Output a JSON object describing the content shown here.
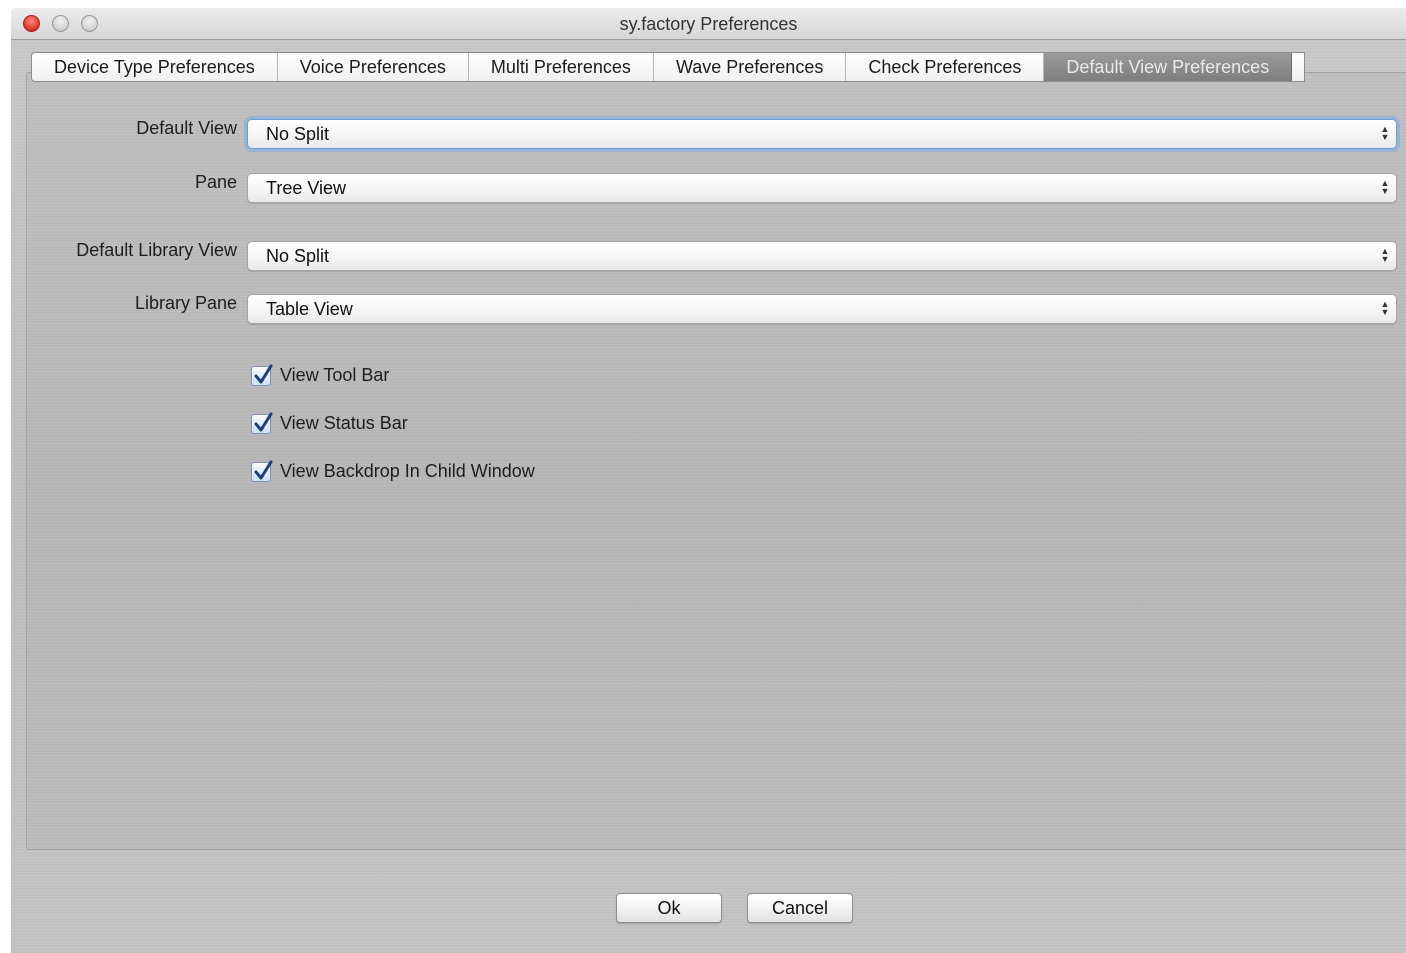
{
  "window": {
    "title": "sy.factory Preferences"
  },
  "tabs": [
    {
      "label": "Device Type Preferences",
      "selected": false
    },
    {
      "label": "Voice Preferences",
      "selected": false
    },
    {
      "label": "Multi Preferences",
      "selected": false
    },
    {
      "label": "Wave Preferences",
      "selected": false
    },
    {
      "label": "Check Preferences",
      "selected": false
    },
    {
      "label": "Default View Preferences",
      "selected": true
    }
  ],
  "form": {
    "default_view": {
      "label": "Default View",
      "value": "No Split"
    },
    "pane": {
      "label": "Pane",
      "value": "Tree View"
    },
    "default_library_view": {
      "label": "Default Library View",
      "value": "No Split"
    },
    "library_pane": {
      "label": "Library Pane",
      "value": "Table View"
    }
  },
  "checkboxes": {
    "tool_bar": {
      "label": "View Tool Bar",
      "checked": true
    },
    "status_bar": {
      "label": "View Status Bar",
      "checked": true
    },
    "backdrop": {
      "label": "View Backdrop In Child Window",
      "checked": true
    }
  },
  "buttons": {
    "ok": "Ok",
    "cancel": "Cancel"
  },
  "colors": {
    "selected_tab": "#8c8c8c",
    "focus_ring": "#78aae6",
    "close_button": "#e0443a"
  }
}
